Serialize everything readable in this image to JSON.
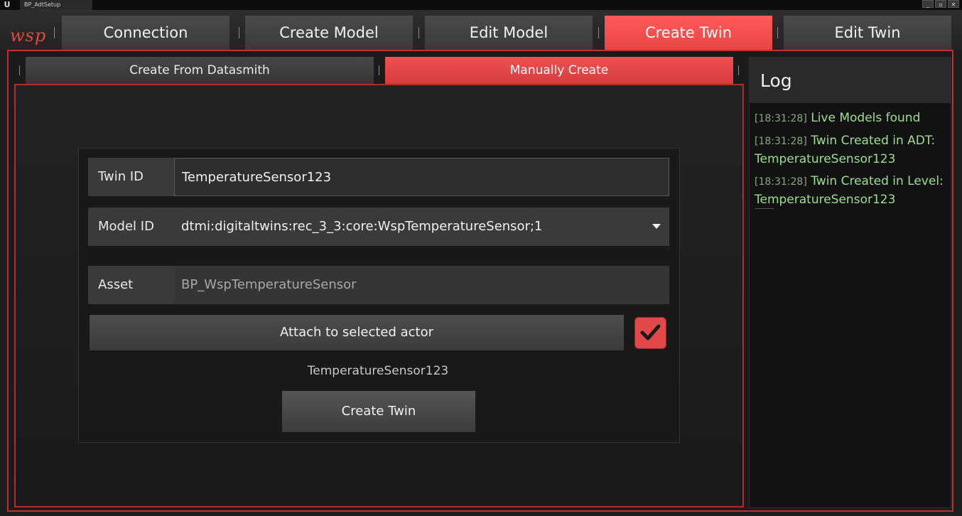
{
  "window": {
    "tab_label": "BP_AdtSetup",
    "buttons": [
      "_",
      "▫",
      "✕"
    ]
  },
  "brand": {
    "logo_text": "wsp",
    "accent": "#e84545"
  },
  "main_tabs": [
    {
      "label": "Connection"
    },
    {
      "label": "Create Model"
    },
    {
      "label": "Edit Model"
    },
    {
      "label": "Create Twin",
      "active": true
    },
    {
      "label": "Edit Twin"
    }
  ],
  "sub_tabs": [
    {
      "label": "Create From Datasmith"
    },
    {
      "label": "Manually Create",
      "active": true
    }
  ],
  "form": {
    "twin_id": {
      "label": "Twin ID",
      "value": "TemperatureSensor123"
    },
    "model_id": {
      "label": "Model ID",
      "value": "dtmi:digitaltwins:rec_3_3:core:WspTemperatureSensor;1"
    },
    "asset": {
      "label": "Asset",
      "value": "BP_WspTemperatureSensor"
    },
    "attach_label": "Attach to selected actor",
    "attach_checked": true,
    "selected_actor_name": "TemperatureSensor123",
    "create_button_label": "Create Twin"
  },
  "log": {
    "title": "Log",
    "entries": [
      {
        "time": "[18:31:28]",
        "message": "Live Models found"
      },
      {
        "time": "[18:31:28]",
        "message": "Twin Created in ADT: TemperatureSensor123"
      },
      {
        "time": "[18:31:28]",
        "message": "Twin Created in Level: TemperatureSensor123"
      }
    ]
  }
}
